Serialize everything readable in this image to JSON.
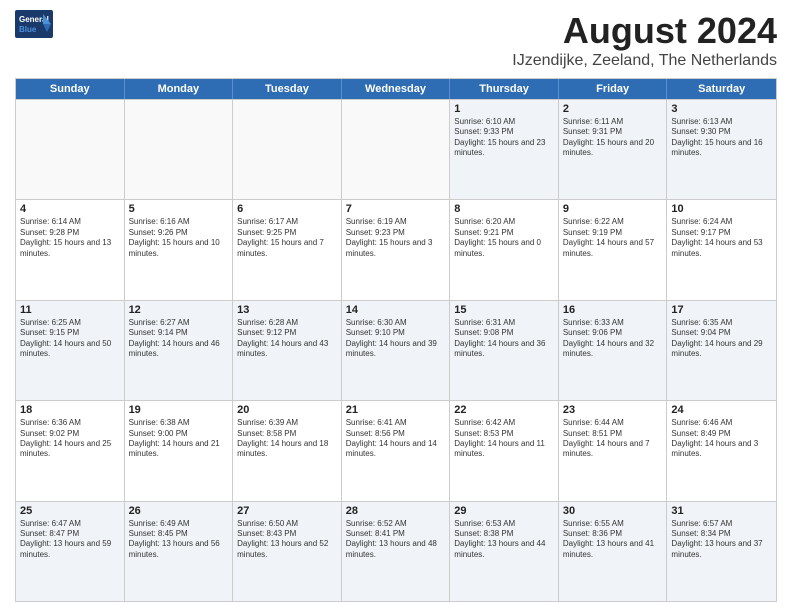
{
  "app": {
    "logo_general": "General",
    "logo_blue": "Blue",
    "logo_tagline": ""
  },
  "title": {
    "month_year": "August 2024",
    "location": "IJzendijke, Zeeland, The Netherlands"
  },
  "days_of_week": [
    "Sunday",
    "Monday",
    "Tuesday",
    "Wednesday",
    "Thursday",
    "Friday",
    "Saturday"
  ],
  "weeks": [
    [
      {
        "day": "",
        "info": ""
      },
      {
        "day": "",
        "info": ""
      },
      {
        "day": "",
        "info": ""
      },
      {
        "day": "",
        "info": ""
      },
      {
        "day": "1",
        "info": "Sunrise: 6:10 AM\nSunset: 9:33 PM\nDaylight: 15 hours and 23 minutes."
      },
      {
        "day": "2",
        "info": "Sunrise: 6:11 AM\nSunset: 9:31 PM\nDaylight: 15 hours and 20 minutes."
      },
      {
        "day": "3",
        "info": "Sunrise: 6:13 AM\nSunset: 9:30 PM\nDaylight: 15 hours and 16 minutes."
      }
    ],
    [
      {
        "day": "4",
        "info": "Sunrise: 6:14 AM\nSunset: 9:28 PM\nDaylight: 15 hours and 13 minutes."
      },
      {
        "day": "5",
        "info": "Sunrise: 6:16 AM\nSunset: 9:26 PM\nDaylight: 15 hours and 10 minutes."
      },
      {
        "day": "6",
        "info": "Sunrise: 6:17 AM\nSunset: 9:25 PM\nDaylight: 15 hours and 7 minutes."
      },
      {
        "day": "7",
        "info": "Sunrise: 6:19 AM\nSunset: 9:23 PM\nDaylight: 15 hours and 3 minutes."
      },
      {
        "day": "8",
        "info": "Sunrise: 6:20 AM\nSunset: 9:21 PM\nDaylight: 15 hours and 0 minutes."
      },
      {
        "day": "9",
        "info": "Sunrise: 6:22 AM\nSunset: 9:19 PM\nDaylight: 14 hours and 57 minutes."
      },
      {
        "day": "10",
        "info": "Sunrise: 6:24 AM\nSunset: 9:17 PM\nDaylight: 14 hours and 53 minutes."
      }
    ],
    [
      {
        "day": "11",
        "info": "Sunrise: 6:25 AM\nSunset: 9:15 PM\nDaylight: 14 hours and 50 minutes."
      },
      {
        "day": "12",
        "info": "Sunrise: 6:27 AM\nSunset: 9:14 PM\nDaylight: 14 hours and 46 minutes."
      },
      {
        "day": "13",
        "info": "Sunrise: 6:28 AM\nSunset: 9:12 PM\nDaylight: 14 hours and 43 minutes."
      },
      {
        "day": "14",
        "info": "Sunrise: 6:30 AM\nSunset: 9:10 PM\nDaylight: 14 hours and 39 minutes."
      },
      {
        "day": "15",
        "info": "Sunrise: 6:31 AM\nSunset: 9:08 PM\nDaylight: 14 hours and 36 minutes."
      },
      {
        "day": "16",
        "info": "Sunrise: 6:33 AM\nSunset: 9:06 PM\nDaylight: 14 hours and 32 minutes."
      },
      {
        "day": "17",
        "info": "Sunrise: 6:35 AM\nSunset: 9:04 PM\nDaylight: 14 hours and 29 minutes."
      }
    ],
    [
      {
        "day": "18",
        "info": "Sunrise: 6:36 AM\nSunset: 9:02 PM\nDaylight: 14 hours and 25 minutes."
      },
      {
        "day": "19",
        "info": "Sunrise: 6:38 AM\nSunset: 9:00 PM\nDaylight: 14 hours and 21 minutes."
      },
      {
        "day": "20",
        "info": "Sunrise: 6:39 AM\nSunset: 8:58 PM\nDaylight: 14 hours and 18 minutes."
      },
      {
        "day": "21",
        "info": "Sunrise: 6:41 AM\nSunset: 8:56 PM\nDaylight: 14 hours and 14 minutes."
      },
      {
        "day": "22",
        "info": "Sunrise: 6:42 AM\nSunset: 8:53 PM\nDaylight: 14 hours and 11 minutes."
      },
      {
        "day": "23",
        "info": "Sunrise: 6:44 AM\nSunset: 8:51 PM\nDaylight: 14 hours and 7 minutes."
      },
      {
        "day": "24",
        "info": "Sunrise: 6:46 AM\nSunset: 8:49 PM\nDaylight: 14 hours and 3 minutes."
      }
    ],
    [
      {
        "day": "25",
        "info": "Sunrise: 6:47 AM\nSunset: 8:47 PM\nDaylight: 13 hours and 59 minutes."
      },
      {
        "day": "26",
        "info": "Sunrise: 6:49 AM\nSunset: 8:45 PM\nDaylight: 13 hours and 56 minutes."
      },
      {
        "day": "27",
        "info": "Sunrise: 6:50 AM\nSunset: 8:43 PM\nDaylight: 13 hours and 52 minutes."
      },
      {
        "day": "28",
        "info": "Sunrise: 6:52 AM\nSunset: 8:41 PM\nDaylight: 13 hours and 48 minutes."
      },
      {
        "day": "29",
        "info": "Sunrise: 6:53 AM\nSunset: 8:38 PM\nDaylight: 13 hours and 44 minutes."
      },
      {
        "day": "30",
        "info": "Sunrise: 6:55 AM\nSunset: 8:36 PM\nDaylight: 13 hours and 41 minutes."
      },
      {
        "day": "31",
        "info": "Sunrise: 6:57 AM\nSunset: 8:34 PM\nDaylight: 13 hours and 37 minutes."
      }
    ]
  ]
}
